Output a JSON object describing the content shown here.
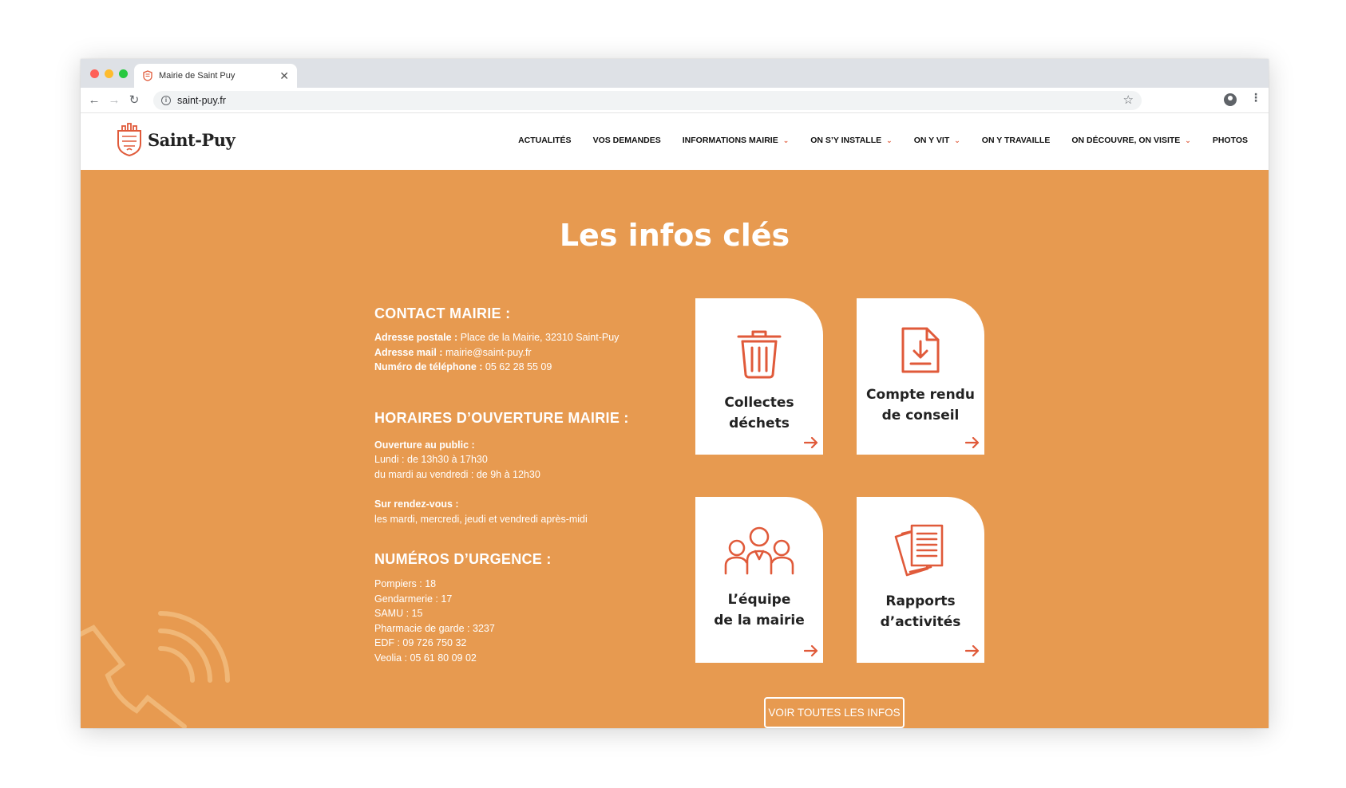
{
  "browser": {
    "tab_title": "Mairie de Saint Puy",
    "url": "saint-puy.fr"
  },
  "site": {
    "logo_name": "Saint-Puy",
    "nav": [
      {
        "label": "ACTUALITÉS",
        "dropdown": false
      },
      {
        "label": "VOS DEMANDES",
        "dropdown": false
      },
      {
        "label": "INFORMATIONS MAIRIE",
        "dropdown": true
      },
      {
        "label": "ON S’Y INSTALLE",
        "dropdown": true
      },
      {
        "label": "ON Y VIT",
        "dropdown": true
      },
      {
        "label": "ON Y TRAVAILLE",
        "dropdown": false
      },
      {
        "label": "ON DÉCOUVRE, ON VISITE",
        "dropdown": true
      },
      {
        "label": "PHOTOS",
        "dropdown": false
      }
    ]
  },
  "main": {
    "title": "Les infos clés",
    "contact": {
      "heading": "CONTACT MAIRIE :",
      "postal_label": "Adresse postale :",
      "postal_value": "Place de la Mairie, 32310 Saint-Puy",
      "mail_label": "Adresse mail :",
      "mail_value": "mairie@saint-puy.fr",
      "phone_label": "Numéro de téléphone :",
      "phone_value": "05 62 28 55 09"
    },
    "hours": {
      "heading": "HORAIRES D’OUVERTURE MAIRIE :",
      "public_label": "Ouverture au public :",
      "public_lines": [
        "Lundi : de 13h30 à 17h30",
        "du mardi au vendredi : de 9h à 12h30"
      ],
      "rdv_label": "Sur rendez-vous :",
      "rdv_line": "les mardi, mercredi, jeudi et vendredi après-midi"
    },
    "urgence": {
      "heading": "NUMÉROS D’URGENCE :",
      "lines": [
        "Pompiers : 18",
        "Gendarmerie : 17",
        "SAMU : 15",
        "Pharmacie de garde : 3237",
        "EDF : 09 726 750 32",
        "Veolia : 05 61 80 09 02"
      ]
    },
    "cards": [
      {
        "label": "Collectes\ndéchets",
        "icon": "trash-icon"
      },
      {
        "label": "Compte rendu\nde conseil",
        "icon": "document-download-icon"
      },
      {
        "label": "L’équipe\nde la mairie",
        "icon": "team-icon"
      },
      {
        "label": "Rapports\nd’activités",
        "icon": "reports-icon"
      }
    ],
    "button_label": "VOIR TOUTES LES INFOS"
  },
  "colors": {
    "accent_orange": "#e79a50",
    "icon_red": "#e05a3a"
  }
}
